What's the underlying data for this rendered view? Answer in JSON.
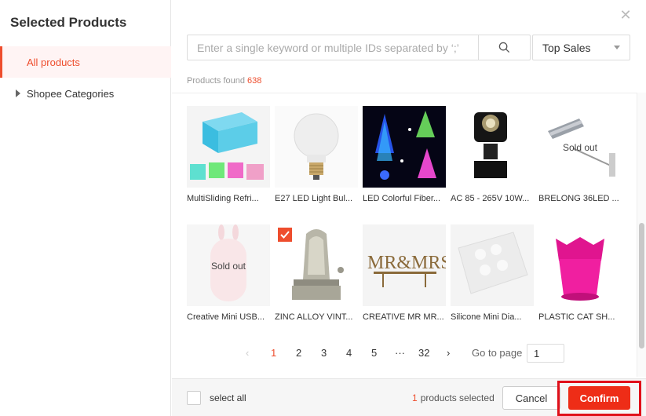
{
  "sidebar": {
    "title": "Selected Products",
    "items": [
      {
        "label": "All products"
      },
      {
        "label": "Shopee Categories"
      }
    ]
  },
  "search": {
    "placeholder": "Enter a single keyword or multiple IDs separated by ‘;’",
    "value": ""
  },
  "sort": {
    "selected": "Top Sales"
  },
  "results": {
    "label": "Products found",
    "count": "638"
  },
  "products": [
    {
      "name": "MultiSliding Refri...",
      "sold_out": ""
    },
    {
      "name": "E27 LED Light Bul...",
      "sold_out": ""
    },
    {
      "name": "LED Colorful Fiber...",
      "sold_out": ""
    },
    {
      "name": "AC 85 - 265V 10W...",
      "sold_out": ""
    },
    {
      "name": "BRELONG 36LED ...",
      "sold_out": "Sold out"
    },
    {
      "name": "Creative Mini USB...",
      "sold_out": "Sold out"
    },
    {
      "name": "ZINC ALLOY VINT...",
      "sold_out": ""
    },
    {
      "name": "CREATIVE MR MR...",
      "sold_out": ""
    },
    {
      "name": "Silicone Mini Dia...",
      "sold_out": ""
    },
    {
      "name": "PLASTIC CAT SH...",
      "sold_out": ""
    }
  ],
  "pagination": {
    "pages": [
      "1",
      "2",
      "3",
      "4",
      "5",
      "···",
      "32"
    ],
    "current": "1",
    "goto_label": "Go to page",
    "goto_value": "1"
  },
  "footer": {
    "select_all": "select all",
    "selected_count": "1",
    "selected_label": "products selected",
    "cancel": "Cancel",
    "confirm": "Confirm"
  },
  "colors": {
    "accent": "#ee4d2d",
    "confirm": "#ee2d17"
  }
}
